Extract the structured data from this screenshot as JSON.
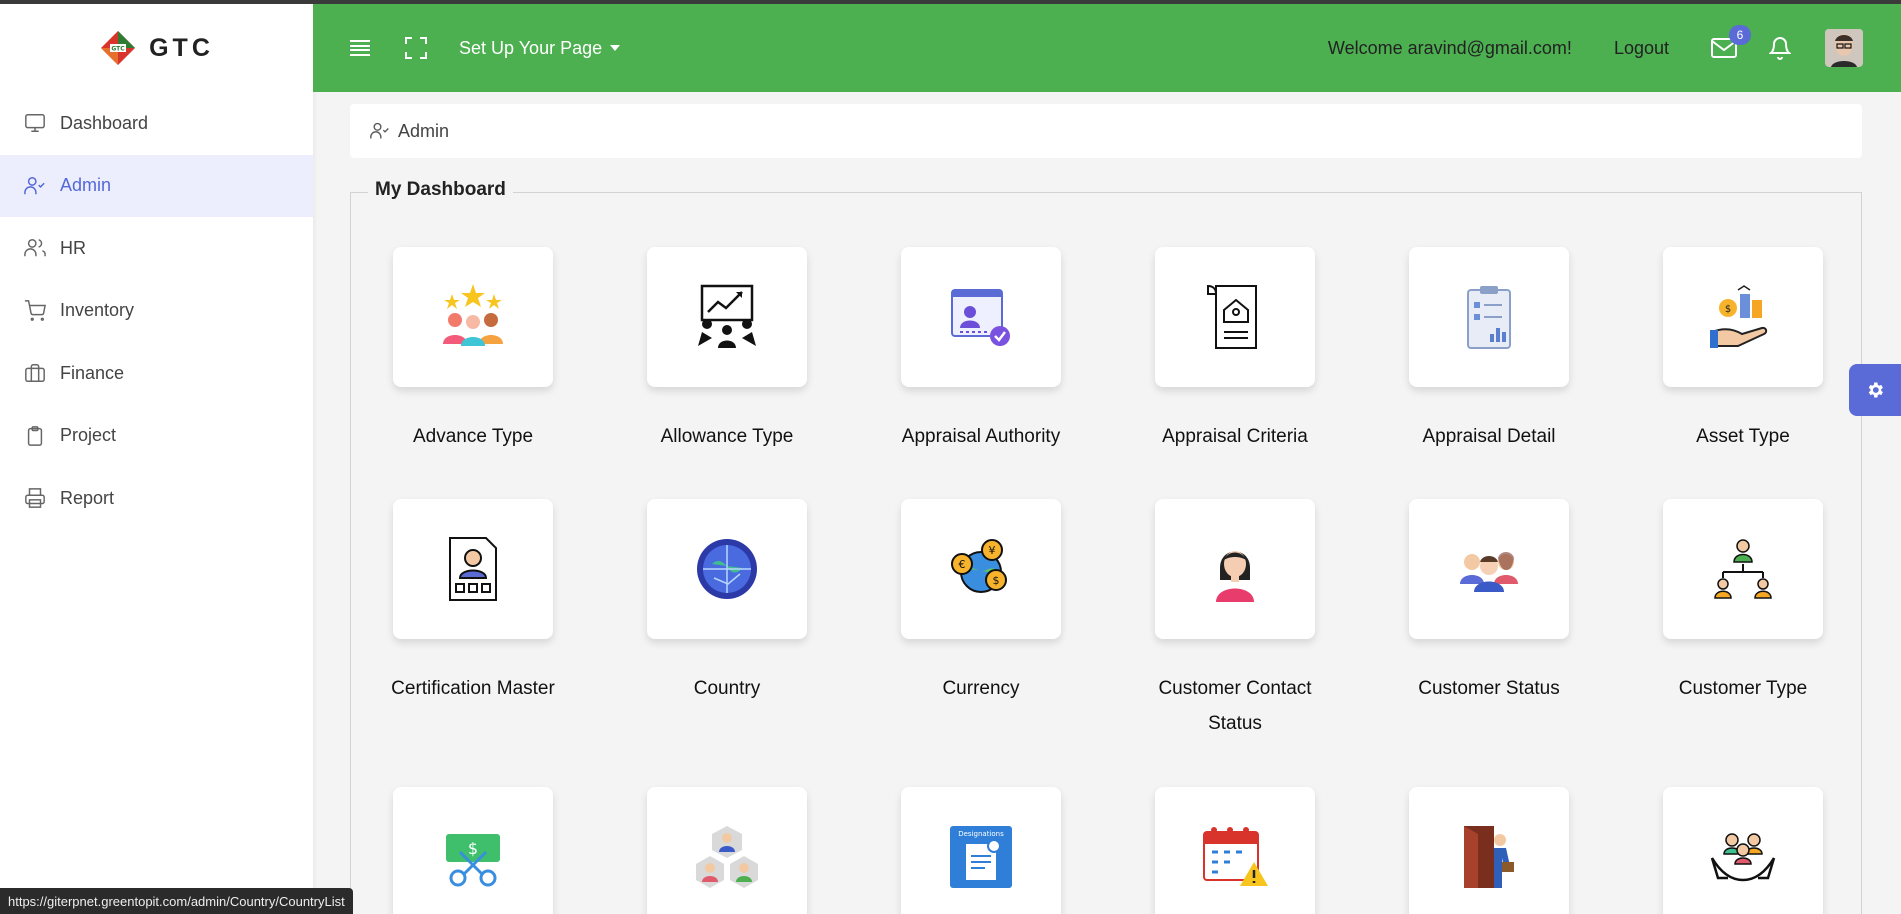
{
  "brand": {
    "name": "GTC"
  },
  "sidebar": {
    "items": [
      {
        "label": "Dashboard",
        "icon": "monitor-icon"
      },
      {
        "label": "Admin",
        "icon": "user-check-icon"
      },
      {
        "label": "HR",
        "icon": "users-icon"
      },
      {
        "label": "Inventory",
        "icon": "cart-icon"
      },
      {
        "label": "Finance",
        "icon": "briefcase-icon"
      },
      {
        "label": "Project",
        "icon": "clipboard-icon"
      },
      {
        "label": "Report",
        "icon": "printer-icon"
      }
    ],
    "active": "Admin"
  },
  "header": {
    "setup_label": "Set Up Your Page",
    "welcome": "Welcome aravind@gmail.com!",
    "logout": "Logout",
    "mail_count": "6"
  },
  "breadcrumb": {
    "label": "Admin"
  },
  "dashboard": {
    "title": "My Dashboard",
    "tiles": [
      {
        "label": "Advance Type",
        "icon": "star-team-icon"
      },
      {
        "label": "Allowance Type",
        "icon": "presentation-icon"
      },
      {
        "label": "Appraisal Authority",
        "icon": "profile-check-icon"
      },
      {
        "label": "Appraisal Criteria",
        "icon": "document-home-icon"
      },
      {
        "label": "Appraisal Detail",
        "icon": "clipboard-chart-icon"
      },
      {
        "label": "Asset Type",
        "icon": "hand-assets-icon"
      },
      {
        "label": "Certification Master",
        "icon": "certificate-icon"
      },
      {
        "label": "Country",
        "icon": "globe-icon"
      },
      {
        "label": "Currency",
        "icon": "currency-globe-icon"
      },
      {
        "label": "Customer Contact Status",
        "icon": "woman-icon"
      },
      {
        "label": "Customer Status",
        "icon": "group-icon"
      },
      {
        "label": "Customer Type",
        "icon": "hierarchy-icon"
      },
      {
        "label": "",
        "icon": "money-scissors-icon"
      },
      {
        "label": "",
        "icon": "team-hexagon-icon"
      },
      {
        "label": "",
        "icon": "designations-icon"
      },
      {
        "label": "",
        "icon": "calendar-warning-icon"
      },
      {
        "label": "",
        "icon": "exit-door-icon"
      },
      {
        "label": "",
        "icon": "care-hands-icon"
      }
    ]
  },
  "designations_icon_text": "Designations",
  "status_url": "https://giterpnet.greentopit.com/admin/Country/CountryList",
  "colors": {
    "header": "#4caf50",
    "accent": "#5468d8",
    "active_bg": "#eceefd"
  }
}
